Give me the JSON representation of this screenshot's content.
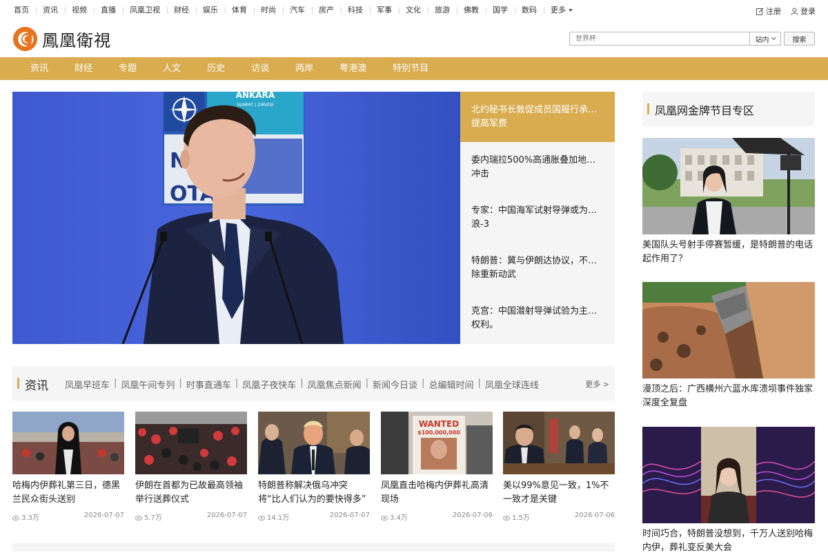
{
  "topnav": {
    "items": [
      "首页",
      "资讯",
      "视频",
      "直播",
      "凤凰卫视",
      "财经",
      "娱乐",
      "体育",
      "时尚",
      "汽车",
      "房产",
      "科技",
      "军事",
      "文化",
      "旅游",
      "佛教",
      "国学",
      "数码",
      "更多"
    ],
    "register": "注册",
    "login": "登录"
  },
  "header": {
    "logo_text": "鳳凰衛視",
    "search_placeholder": "世界杯",
    "search_scope": "站内",
    "search_button": "搜索"
  },
  "channelbar": {
    "items": [
      "资讯",
      "财经",
      "专题",
      "人文",
      "历史",
      "访谈",
      "两岸",
      "粤港澳",
      "特别节目"
    ]
  },
  "hero": {
    "headlines": [
      "北约秘书长敦促成员国履行承…提高军费",
      "委内瑞拉500%高通胀叠加地…冲击",
      "专家：中国海军试射导弹或为…浪-3",
      "特朗普：冀与伊朗达协议，不…除重新动武",
      "克宫：中国潜射导弹试验为主…权利。"
    ],
    "active_index": 0,
    "image_texts": {
      "banner_city": "ANKARA",
      "banner_line": "SUMMIT | ZIRVESİ",
      "letters_1": "NA",
      "letters_2": "OTA"
    }
  },
  "section": {
    "title": "资讯",
    "subs": [
      "凤凰早班车",
      "凤凰午间专列",
      "时事直通车",
      "凤凰子夜快车",
      "凤凰焦点新闻",
      "新闻今日谈",
      "总编辑时间",
      "凤凰全球连线"
    ],
    "more": "更多 >"
  },
  "cards": [
    {
      "title": "哈梅内伊葬礼第三日，德黑兰民众街头送别",
      "views": "3.3万",
      "date": "2026-07-07"
    },
    {
      "title": "伊朗在首都为已故最高领袖举行送葬仪式",
      "views": "5.7万",
      "date": "2026-07-07"
    },
    {
      "title": "特朗普称解决俄乌冲突将“比人们认为的要快得多”",
      "views": "14.1万",
      "date": "2026-07-07"
    },
    {
      "title": "凤凰直击哈梅内伊葬礼高清现场",
      "views": "3.4万",
      "date": "2026-07-06",
      "poster_text": "WANTED",
      "poster_amount": "$100,000,000"
    },
    {
      "title": "美以99%意见一致，1%不一致才是关键",
      "views": "1.5万",
      "date": "2026-07-06"
    }
  ],
  "right_column": {
    "title": "凤凰网金牌节目专区",
    "items": [
      {
        "title": "美国队头号射手停赛暂缓，是特朗普的电话起作用了？"
      },
      {
        "title": "漫顶之后：广西横州六蓝水库溃坝事件独家深度全复盘"
      },
      {
        "title": "时间巧合，特朗普没想到，千万人送别哈梅内伊，葬礼变反美大会"
      }
    ]
  },
  "colors": {
    "gold": "#d8ac4f",
    "panel": "#f5f5f5",
    "logo_orange": "#e8731f"
  }
}
